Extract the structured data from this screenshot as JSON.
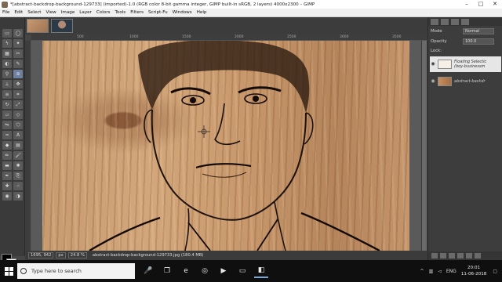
{
  "window": {
    "title": "*[abstract-backdrop-background-129733] (imported)-1.0 (RGB color 8-bit gamma integer, GIMP built-in sRGB, 2 layers) 4000x2300 – GIMP",
    "controls": [
      "–",
      "□",
      "✕"
    ]
  },
  "menu": [
    "File",
    "Edit",
    "Select",
    "View",
    "Image",
    "Layer",
    "Colors",
    "Tools",
    "Filters",
    "Script-Fu",
    "Windows",
    "Help"
  ],
  "ruler": {
    "marks": [
      "500",
      "1000",
      "1500",
      "2000",
      "2500",
      "3000",
      "3500"
    ]
  },
  "statusbar": {
    "coords": "1695, 942",
    "unit": "px",
    "zoom": "24.8 %",
    "info": "abstract-backdrop-background-129733.jpg (180.4 MB)"
  },
  "dock": {
    "mode_label": "Mode",
    "mode_value": "Normal",
    "opacity_label": "Opacity",
    "opacity_value": "100.0",
    "lock_label": "Lock:"
  },
  "layers": [
    {
      "name_line1": "Floating Selectic",
      "name_line2": "(boy-businessm",
      "active": true
    },
    {
      "name_line1": "abstract-backdr",
      "name_line2": "",
      "active": false
    }
  ],
  "taskbar": {
    "search_placeholder": "Type here to search",
    "language": "ENG",
    "time": "20:01",
    "date": "11-06-2018"
  }
}
